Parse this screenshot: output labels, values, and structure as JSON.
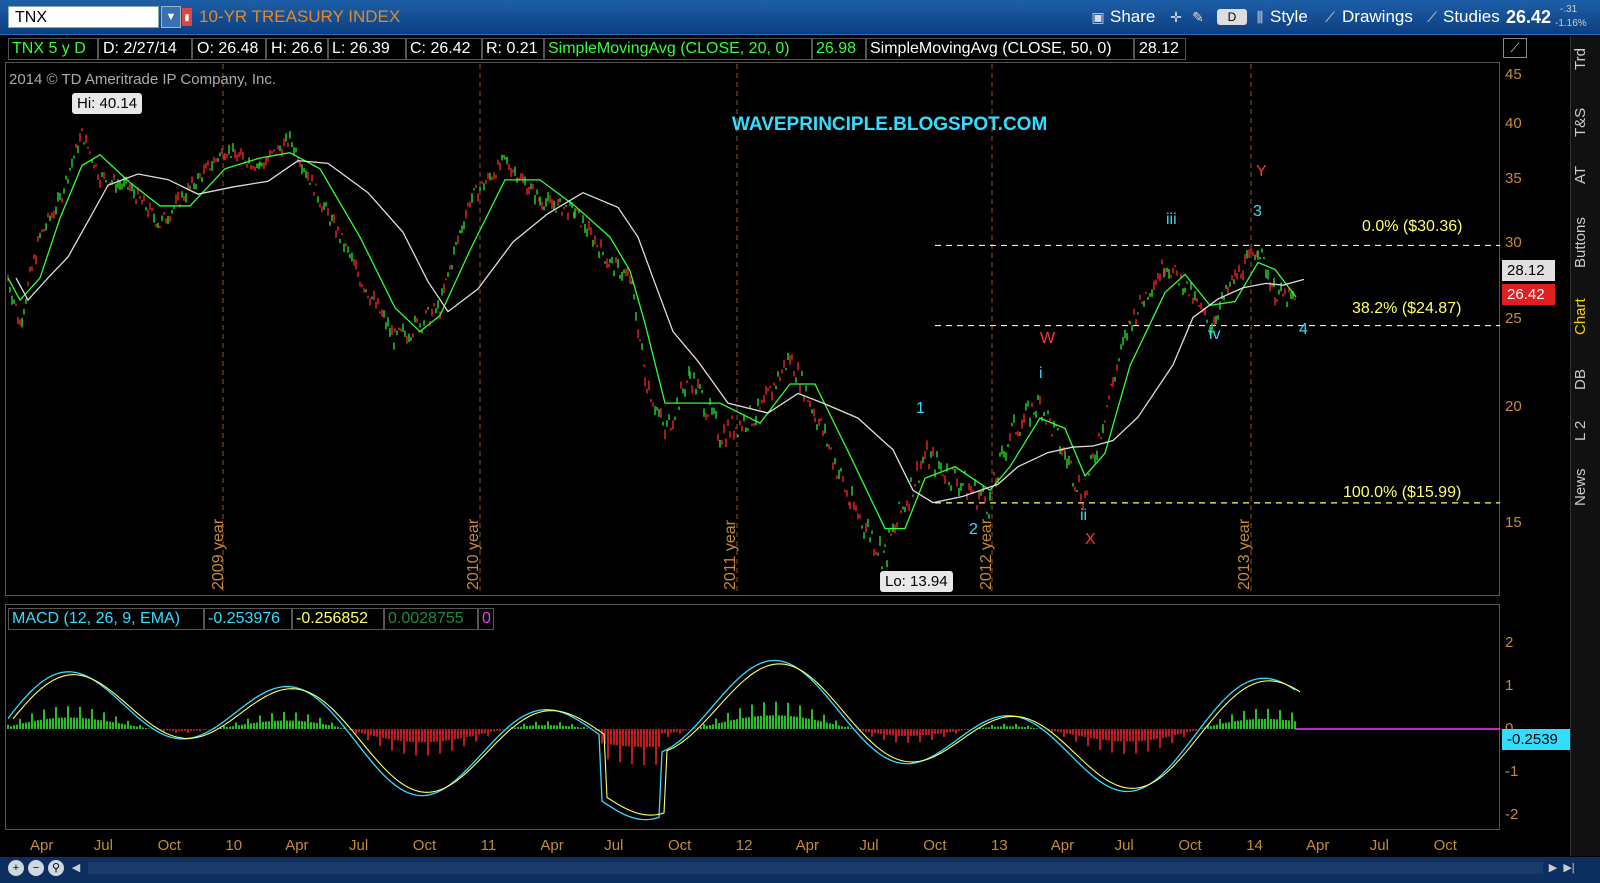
{
  "header": {
    "symbol": "TNX",
    "title": "10-YR TREASURY INDEX",
    "share_label": "Share",
    "d_label": "D",
    "style_label": "Style",
    "drawings_label": "Drawings",
    "studies_label": "Studies",
    "last_price": "26.42",
    "change": "-.31",
    "change_pct": "-1.16%"
  },
  "studybar": {
    "desc": "TNX 5 y D",
    "date": "D: 2/27/14",
    "open": "O: 26.48",
    "high": "H: 26.6",
    "low": "L: 26.39",
    "close": "C: 26.42",
    "range": "R: 0.21",
    "sma20_label": "SimpleMovingAvg (CLOSE, 20, 0)",
    "sma20_value": "26.98",
    "sma50_label": "SimpleMovingAvg (CLOSE, 50, 0)",
    "sma50_value": "28.12"
  },
  "chart": {
    "copyright": "2014 © TD Ameritrade IP Company, Inc.",
    "watermark": "WAVEPRINCIPLE.BLOGSPOT.COM",
    "hi_label": "Hi: 40.14",
    "lo_label": "Lo: 13.94",
    "price_axis": [
      "45",
      "40",
      "35",
      "30",
      "25",
      "20",
      "15"
    ],
    "sma50_flag": "28.12",
    "price_flag": "26.42",
    "fib": [
      {
        "label": "0.0%  ($30.36)",
        "value": 30.36
      },
      {
        "label": "38.2%  ($24.87)",
        "value": 24.87
      },
      {
        "label": "100.0%  ($15.99)",
        "value": 15.99
      }
    ],
    "year_markers": [
      "2009 year",
      "2010 year",
      "2011 year",
      "2012 year",
      "2013 year"
    ],
    "waves": {
      "W": "W",
      "X": "X",
      "Y": "Y",
      "i": "i",
      "ii": "ii",
      "iii": "iii",
      "iv": "iv",
      "n1": "1",
      "n2": "2",
      "n3": "3",
      "n4": "4"
    }
  },
  "macd": {
    "label": "MACD (12, 26, 9, EMA)",
    "value": "-0.253976",
    "avg": "-0.256852",
    "diff": "0.0028755",
    "zero": "0",
    "axis": [
      "2",
      "1",
      "0",
      "-1",
      "-2"
    ],
    "flag": "-0.2539"
  },
  "xaxis": [
    "Apr",
    "Jul",
    "Oct",
    "10",
    "Apr",
    "Jul",
    "Oct",
    "11",
    "Apr",
    "Jul",
    "Oct",
    "12",
    "Apr",
    "Jul",
    "Oct",
    "13",
    "Apr",
    "Jul",
    "Oct",
    "14",
    "Apr",
    "Jul",
    "Oct"
  ],
  "sidetabs": [
    "Trd",
    "T&S",
    "AT",
    "Buttons",
    "Chart",
    "DB",
    "L 2",
    "News"
  ],
  "colors": {
    "cyan": "#33ddff",
    "yellow": "#ffff66",
    "red": "#ff3333",
    "green": "#33ff33",
    "axis": "#c88a3a"
  }
}
